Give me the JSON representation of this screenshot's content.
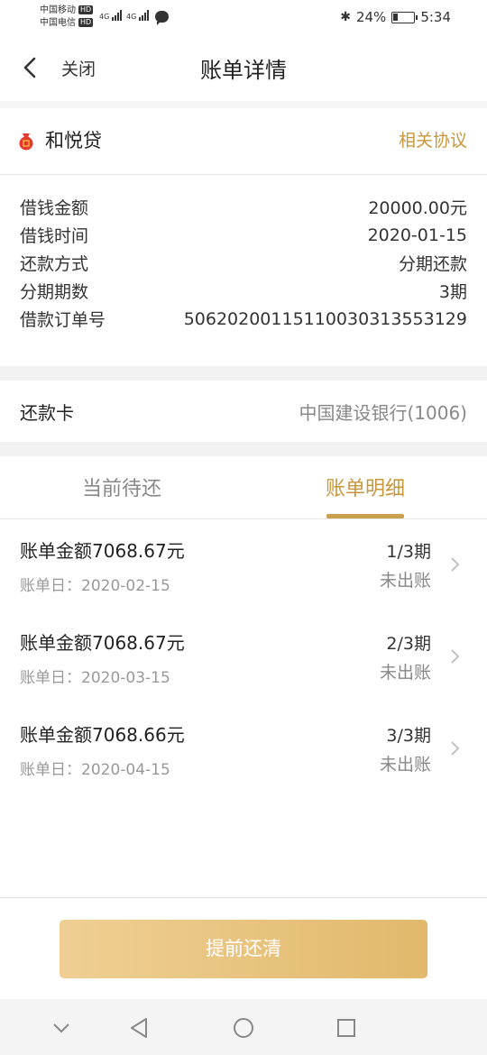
{
  "status_bar": {
    "carrier1": "中国移动",
    "carrier2": "中国电信",
    "hd": "HD",
    "net1": "4G",
    "net2": "4G",
    "battery_text": "24%",
    "battery_level": 0.24,
    "time": "5:34"
  },
  "header": {
    "close_label": "关闭",
    "title": "账单详情"
  },
  "product": {
    "name": "和悦贷",
    "agreement_label": "相关协议"
  },
  "info": [
    {
      "label": "借钱金额",
      "value": "20000.00元"
    },
    {
      "label": "借钱时间",
      "value": "2020-01-15"
    },
    {
      "label": "还款方式",
      "value": "分期还款"
    },
    {
      "label": "分期期数",
      "value": "3期"
    },
    {
      "label": "借款订单号",
      "value": "5062020011511003031355312 9"
    }
  ],
  "card": {
    "label": "还款卡",
    "value": "中国建设银行(1006)"
  },
  "tabs": {
    "current": "当前待还",
    "detail": "账单明细"
  },
  "bills": [
    {
      "amount": "账单金额7068.67元",
      "date": "账单日：2020-02-15",
      "period": "1/3期",
      "status": "未出账"
    },
    {
      "amount": "账单金额7068.67元",
      "date": "账单日：2020-03-15",
      "period": "2/3期",
      "status": "未出账"
    },
    {
      "amount": "账单金额7068.66元",
      "date": "账单日：2020-04-15",
      "period": "3/3期",
      "status": "未出账"
    }
  ],
  "payoff_label": "提前还清",
  "colors": {
    "accent": "#c9973a",
    "button_start": "#efcf93",
    "button_end": "#e1b96c"
  }
}
